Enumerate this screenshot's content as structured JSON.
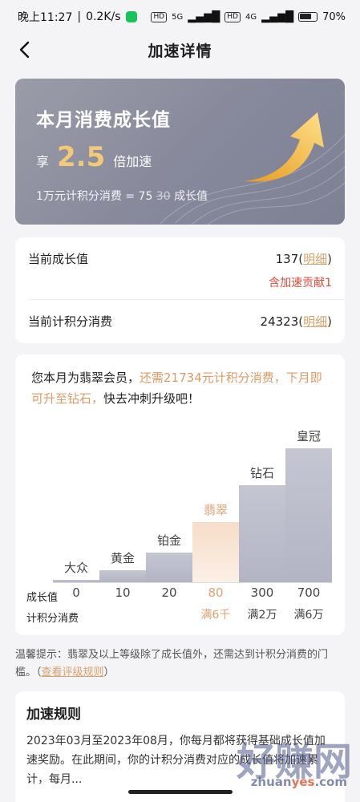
{
  "status": {
    "time": "晚上11:27",
    "speed": "0.2K/s",
    "net_5g": "5G",
    "net_4g": "4G",
    "hd": "HD",
    "battery": "70%"
  },
  "nav": {
    "title": "加速详情"
  },
  "hero": {
    "title": "本月消费成长值",
    "accel_prefix": "享",
    "accel_value": "2.5",
    "accel_suffix": "倍加速",
    "rule_prefix": "1万元计积分消费 = 75",
    "rule_old": "30",
    "rule_suffix": "成长值"
  },
  "stats": {
    "growth_label": "当前成长值",
    "growth_value": "137",
    "detail_link": "明细",
    "paren_open": "(",
    "paren_close": ")",
    "contribution": "含加速贡献1",
    "spend_label": "当前计积分消费",
    "spend_value": "24323"
  },
  "tip": {
    "part1": "您本月为翡翠会员，",
    "highlight": "还需21734元计积分消费，下月即可升至钻石，",
    "part2": "快去冲刺升级吧！"
  },
  "chart_data": {
    "type": "bar",
    "categories": [
      "大众",
      "黄金",
      "铂金",
      "翡翠",
      "钻石",
      "皇冠"
    ],
    "values": [
      0,
      10,
      20,
      80,
      300,
      700
    ],
    "growth_labels": [
      "0",
      "10",
      "20",
      "80",
      "300",
      "700"
    ],
    "spend_labels": [
      "",
      "",
      "",
      "满6千",
      "满2万",
      "满6万"
    ],
    "current_index": 3,
    "row_label_growth": "成长值",
    "row_label_spend": "计积分消费",
    "accent_color": "#e4a070",
    "bar_color": "#b8bac8"
  },
  "notice": {
    "text": "温馨提示：翡翠及以上等级除了成长值外，还需达到计积分消费的门槛。（",
    "link": "查看评级规则",
    "close": "）"
  },
  "rules": {
    "title": "加速规则",
    "body": "2023年03月至2023年08月，你每月都将获得基础成长值加速奖励。在此期间，你的计积分消费对应的成长值将加速累计，每月..."
  },
  "watermark": {
    "text": "好赚网",
    "site_a": "zhuan",
    "site_b": "yes",
    "site_c": ".com"
  }
}
